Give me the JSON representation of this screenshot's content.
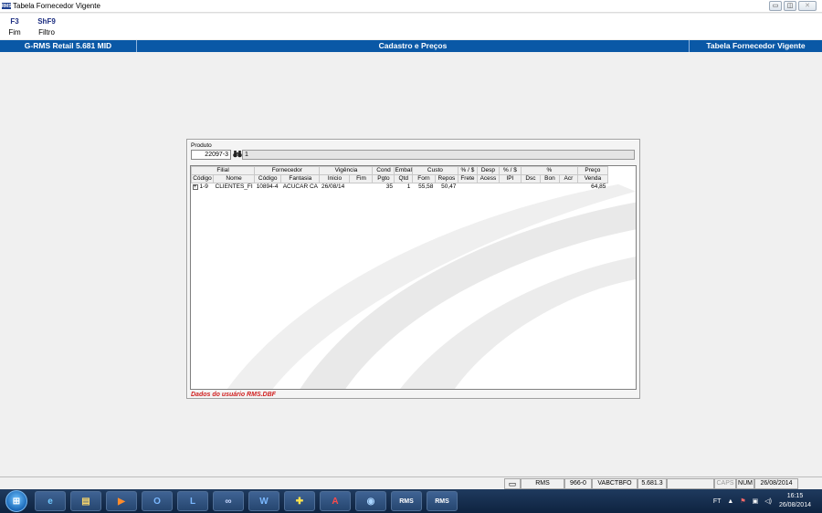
{
  "window": {
    "title": "Tabela Fornecedor Vigente",
    "app_icon": "RMS"
  },
  "window_controls": {
    "minimize": "▭",
    "maximize": "◫",
    "close": "✕"
  },
  "fkeys": [
    {
      "key": "F3",
      "label": "Fim"
    },
    {
      "key": "ShF9",
      "label": "Filtro"
    }
  ],
  "band": {
    "left": "G-RMS Retail 5.681 MID",
    "center": "Cadastro e Preços",
    "right": "Tabela Fornecedor Vigente"
  },
  "produto": {
    "label": "Produto",
    "code": "22097-3",
    "description": "1",
    "search_icon": "binoculars-icon"
  },
  "grid": {
    "groups": [
      {
        "label": "Filial",
        "span": 2
      },
      {
        "label": "Fornecedor",
        "span": 2
      },
      {
        "label": "Vigência",
        "span": 2
      },
      {
        "label": "Cond",
        "span": 1
      },
      {
        "label": "Embal",
        "span": 1
      },
      {
        "label": "Custo",
        "span": 2
      },
      {
        "label": "% / $",
        "span": 1
      },
      {
        "label": "Desp",
        "span": 1
      },
      {
        "label": "% / $",
        "span": 1
      },
      {
        "label": "%",
        "span": 3
      },
      {
        "label": "Preço",
        "span": 1
      }
    ],
    "columns": [
      "Código",
      "Nome",
      "Código",
      "Fantasia",
      "Inicio",
      "Fim",
      "Pgto",
      "Qtd",
      "Forn",
      "Repos",
      "Frete",
      "Acess",
      "IPI",
      "Dsc",
      "Bon",
      "Acr",
      "Venda"
    ],
    "rows": [
      {
        "expander": "+",
        "cells": [
          "1-9",
          "CLIENTES_FI",
          "10894-4",
          "ACUCAR CA",
          "26/08/14",
          "",
          "35",
          "1",
          "55,58",
          "50,47",
          "",
          "",
          "",
          "",
          "",
          "",
          "64,85"
        ]
      }
    ]
  },
  "footer_info": "Dados do usuário RMS.DBF",
  "statusbar": [
    "RMS",
    "966-0",
    "VABCTBFO",
    "5.681.3",
    "",
    "CAPS",
    "NUM",
    "26/08/2014"
  ],
  "taskbar": {
    "apps": [
      "ie-icon",
      "explorer-icon",
      "media-player-icon",
      "outlook-icon",
      "lync-icon",
      "cooperation-icon",
      "word-icon",
      "app-plus-icon",
      "acrobat-icon",
      "network-icon",
      "rms-icon",
      "rms-icon"
    ],
    "app_labels": [
      "RMS",
      "RMS"
    ],
    "tray_lang": "FT",
    "time": "16:15",
    "date": "26/08/2014"
  },
  "colors": {
    "band": "#0a58a6",
    "fkey": "#1c2d80",
    "info": "#d01e1e"
  }
}
